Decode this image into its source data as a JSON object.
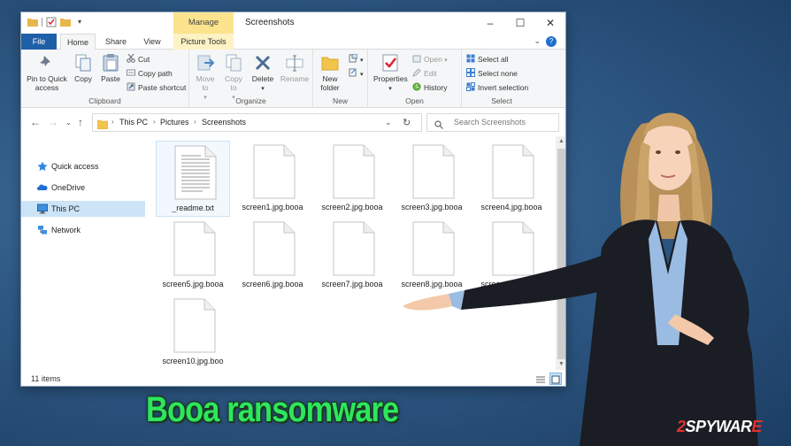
{
  "window": {
    "title": "Screenshots",
    "context_tab": "Manage",
    "controls": [
      "–",
      "☐",
      "✕"
    ]
  },
  "tabs": [
    {
      "label": "File"
    },
    {
      "label": "Home"
    },
    {
      "label": "Share"
    },
    {
      "label": "View"
    },
    {
      "label": "Picture Tools"
    }
  ],
  "ribbon": {
    "clipboard": {
      "label": "Clipboard",
      "pin": "Pin to Quick access",
      "copy": "Copy",
      "paste": "Paste",
      "cut": "Cut",
      "copy_path": "Copy path",
      "paste_shortcut": "Paste shortcut"
    },
    "organize": {
      "label": "Organize",
      "move_to": "Move to",
      "copy_to": "Copy to",
      "delete": "Delete",
      "rename": "Rename"
    },
    "new": {
      "label": "New",
      "new_folder": "New folder"
    },
    "open": {
      "label": "Open",
      "properties": "Properties",
      "open": "Open",
      "edit": "Edit",
      "history": "History"
    },
    "select": {
      "label": "Select",
      "select_all": "Select all",
      "select_none": "Select none",
      "invert_selection": "Invert selection"
    }
  },
  "address": {
    "breadcrumbs": [
      "This PC",
      "Pictures",
      "Screenshots"
    ],
    "search_placeholder": "Search Screenshots"
  },
  "nav_pane": [
    {
      "label": "Quick access",
      "icon": "star-icon"
    },
    {
      "label": "OneDrive",
      "icon": "cloud-icon"
    },
    {
      "label": "This PC",
      "icon": "monitor-icon",
      "selected": true
    },
    {
      "label": "Network",
      "icon": "network-icon"
    }
  ],
  "files": [
    {
      "name": "_readme.txt",
      "type": "text"
    },
    {
      "name": "screen1.jpg.booa",
      "type": "blank"
    },
    {
      "name": "screen2.jpg.booa",
      "type": "blank"
    },
    {
      "name": "screen3.jpg.booa",
      "type": "blank"
    },
    {
      "name": "screen4.jpg.booa",
      "type": "blank"
    },
    {
      "name": "screen5.jpg.booa",
      "type": "blank"
    },
    {
      "name": "screen6.jpg.booa",
      "type": "blank"
    },
    {
      "name": "screen7.jpg.booa",
      "type": "blank"
    },
    {
      "name": "screen8.jpg.booa",
      "type": "blank"
    },
    {
      "name": "screen9.jpg.booa",
      "type": "blank"
    },
    {
      "name": "screen10.jpg.boo",
      "type": "blank"
    }
  ],
  "status": {
    "item_count": "11 items"
  },
  "headline": "Booa ransomware",
  "brand": {
    "digit": "2",
    "middle": "SPYWAR",
    "end": "E"
  },
  "colors": {
    "accent": "#1f5fa8",
    "manage_tab": "#fbe48d",
    "selection": "#cce4f7",
    "headline": "#2ee65e",
    "brand_red": "#e5322d"
  }
}
